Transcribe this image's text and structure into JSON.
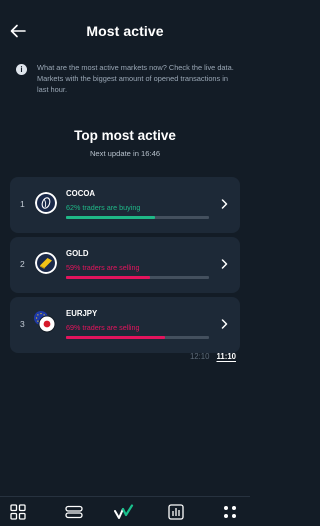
{
  "header": {
    "title": "Most active",
    "back_icon": "arrow-left-icon"
  },
  "info": {
    "icon": "info-icon",
    "icon_glyph": "i",
    "text": "What are the most active markets now? Check the live data. Markets with the biggest amount of opened transactions in last hour."
  },
  "main": {
    "title": "Top most active",
    "next_update": "Next update in 16:46"
  },
  "items": [
    {
      "rank": "1",
      "name": "COCOA",
      "status": "62% traders are buying",
      "percent": 62,
      "direction": "buying",
      "color": "#1fb887",
      "icon": "cocoa-bean-icon"
    },
    {
      "rank": "2",
      "name": "GOLD",
      "status": "59% traders are selling",
      "percent": 59,
      "direction": "selling",
      "color": "#e3145d",
      "icon": "gold-bar-icon"
    },
    {
      "rank": "3",
      "name": "EURJPY",
      "status": "69% traders are selling",
      "percent": 69,
      "direction": "selling",
      "color": "#e3145d",
      "icon": "eur-jpy-flags-icon"
    }
  ],
  "time_tabs": [
    {
      "label": "12:10",
      "active": false
    },
    {
      "label": "11:10",
      "active": true
    }
  ],
  "bottom_nav": [
    {
      "name": "markets",
      "icon": "grid-icon"
    },
    {
      "name": "positions",
      "icon": "stacked-rows-icon"
    },
    {
      "name": "home",
      "icon": "brand-logo-icon"
    },
    {
      "name": "portfolio",
      "icon": "bar-chart-icon"
    },
    {
      "name": "more",
      "icon": "dots-icon"
    }
  ],
  "colors": {
    "background": "#131c26",
    "card": "#1d2937",
    "buy": "#1fb887",
    "sell": "#e3145d",
    "track": "#44505e"
  }
}
